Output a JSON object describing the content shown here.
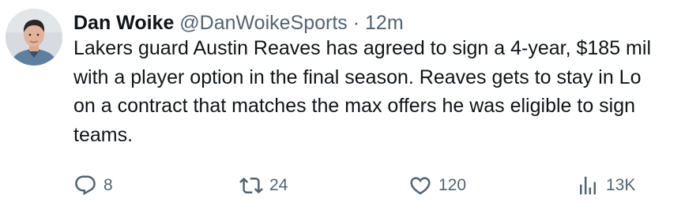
{
  "tweet": {
    "author": {
      "display_name": "Dan Woike",
      "handle": "@DanWoikeSports",
      "separator": "·",
      "time": "12m",
      "avatar_icon": "profile-photo"
    },
    "text_lines": [
      "Lakers guard Austin Reaves has agreed to sign a 4-year, $185 mil",
      "with a player option in the final season. Reaves gets to stay in Lo",
      "on a contract that matches the max offers he was eligible to sign",
      "teams."
    ],
    "actions": {
      "reply": {
        "count": "8",
        "icon": "reply-icon"
      },
      "retweet": {
        "count": "24",
        "icon": "retweet-icon"
      },
      "like": {
        "count": "120",
        "icon": "heart-icon"
      },
      "views": {
        "count": "13K",
        "icon": "analytics-icon"
      }
    },
    "colors": {
      "text_primary": "#0f1419",
      "text_secondary": "#536471",
      "background": "#ffffff"
    }
  }
}
